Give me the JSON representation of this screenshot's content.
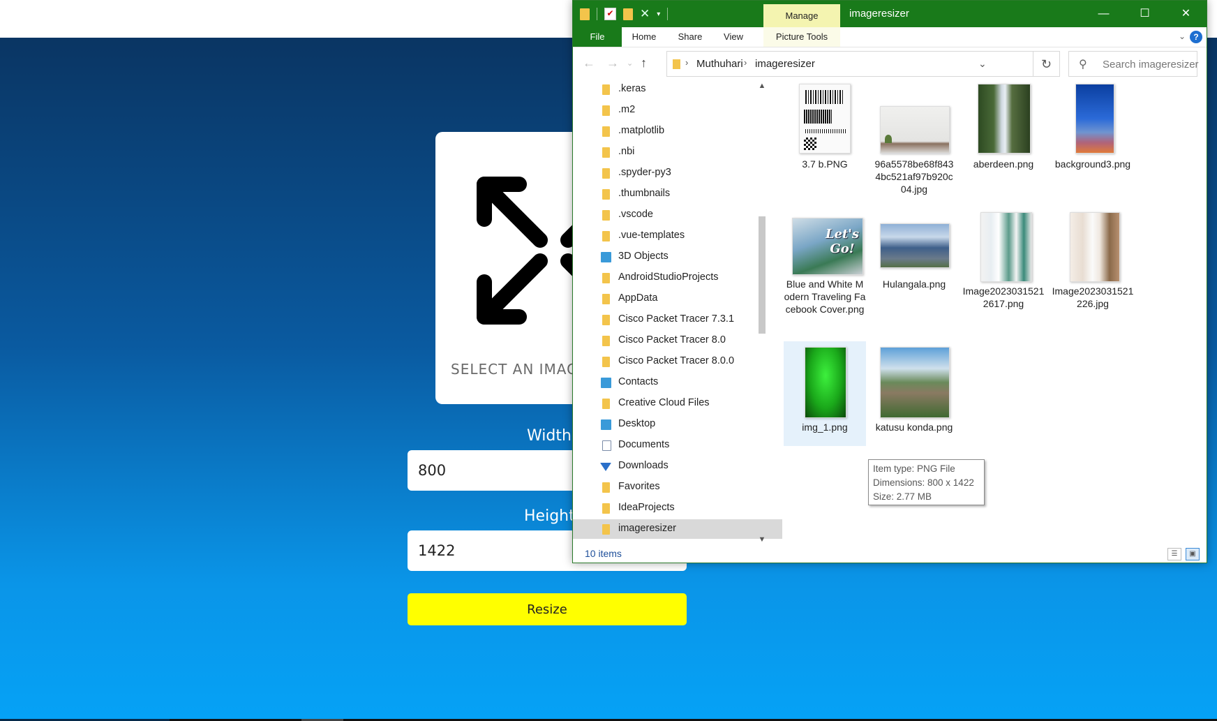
{
  "app": {
    "select_label": "SELECT AN IMAGE",
    "width_label": "Width",
    "width_value": "800",
    "height_label": "Height",
    "height_value": "1422",
    "resize_label": "Resize"
  },
  "explorer": {
    "title": "imageresizer",
    "manage_tab": "Manage",
    "ribbon_tabs": [
      "File",
      "Home",
      "Share",
      "View",
      "Picture Tools"
    ],
    "breadcrumb": [
      "Muthuhari",
      "imageresizer"
    ],
    "search_placeholder": "Search imageresizer",
    "nav_items": [
      {
        "label": ".keras",
        "icon": "folder-icon"
      },
      {
        "label": ".m2",
        "icon": "folder-icon"
      },
      {
        "label": ".matplotlib",
        "icon": "folder-icon"
      },
      {
        "label": ".nbi",
        "icon": "folder-icon"
      },
      {
        "label": ".spyder-py3",
        "icon": "folder-icon"
      },
      {
        "label": ".thumbnails",
        "icon": "folder-icon"
      },
      {
        "label": ".vscode",
        "icon": "folder-icon"
      },
      {
        "label": ".vue-templates",
        "icon": "folder-icon"
      },
      {
        "label": "3D Objects",
        "icon": "3d-objects-icon"
      },
      {
        "label": "AndroidStudioProjects",
        "icon": "folder-icon"
      },
      {
        "label": "AppData",
        "icon": "folder-icon"
      },
      {
        "label": "Cisco Packet Tracer 7.3.1",
        "icon": "folder-icon"
      },
      {
        "label": "Cisco Packet Tracer 8.0",
        "icon": "folder-icon"
      },
      {
        "label": "Cisco Packet Tracer 8.0.0",
        "icon": "folder-icon"
      },
      {
        "label": "Contacts",
        "icon": "contacts-icon"
      },
      {
        "label": "Creative Cloud Files",
        "icon": "folder-icon"
      },
      {
        "label": "Desktop",
        "icon": "desktop-icon"
      },
      {
        "label": "Documents",
        "icon": "documents-icon"
      },
      {
        "label": "Downloads",
        "icon": "downloads-icon"
      },
      {
        "label": "Favorites",
        "icon": "favorites-icon"
      },
      {
        "label": "IdeaProjects",
        "icon": "folder-icon"
      },
      {
        "label": "imageresizer",
        "icon": "folder-icon",
        "selected": true
      }
    ],
    "files": [
      {
        "name": "3.7 b.PNG"
      },
      {
        "name": "96a5578be68f8434bc521af97b920c04.jpg"
      },
      {
        "name": "aberdeen.png"
      },
      {
        "name": "background3.png"
      },
      {
        "name": "Blue and White Modern Traveling Facebook Cover.png"
      },
      {
        "name": "Hulangala.png"
      },
      {
        "name": "Image20230315212617.png"
      },
      {
        "name": "Image2023031521226.jpg"
      },
      {
        "name": "img_1.png",
        "selected": true
      },
      {
        "name": "katusu konda.png"
      }
    ],
    "tooltip": {
      "type": "Item type: PNG File",
      "dimensions": "Dimensions: 800 x 1422",
      "size": "Size: 2.77 MB"
    },
    "status": "10 items",
    "colors": {
      "titlebar": "#197a1a",
      "manage_tab": "#f4f4b0",
      "resize_button": "#ffff00"
    }
  }
}
